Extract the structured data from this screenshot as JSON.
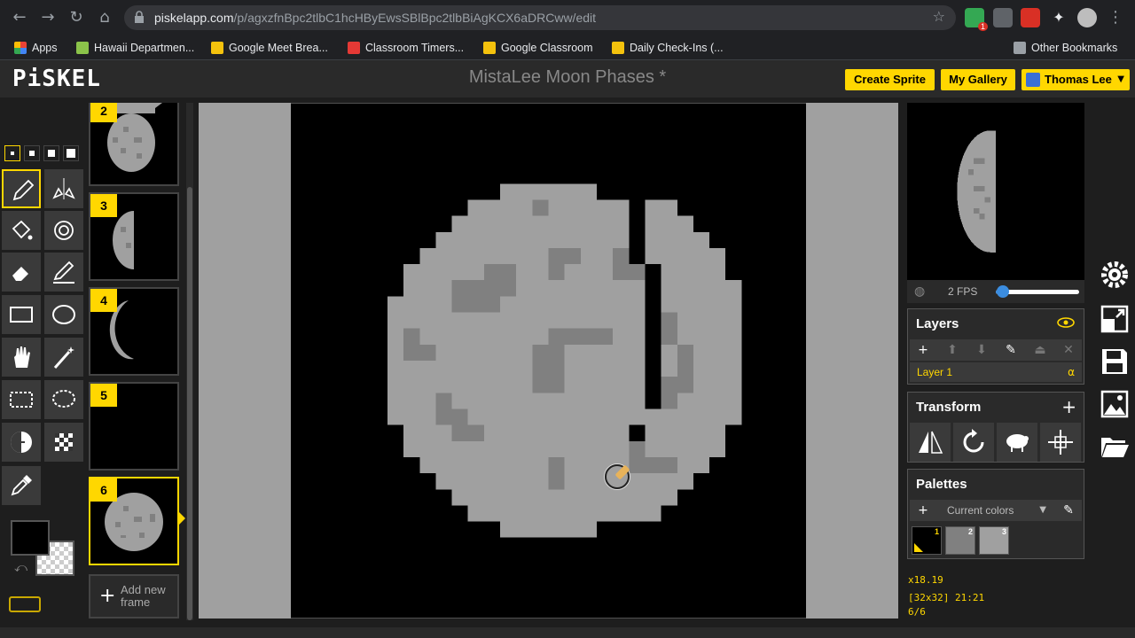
{
  "browser": {
    "url_host": "piskelapp.com",
    "url_path": "/p/agxzfnBpc2tlbC1hcHByEwsSBlBpc2tlbBiAgKCX6aDRCww/edit",
    "ext_badge": "1",
    "bookmarks": [
      {
        "label": "Apps",
        "color": "#ea4335"
      },
      {
        "label": "Hawaii Departmen...",
        "color": "#8bc34a"
      },
      {
        "label": "Google Meet Brea...",
        "color": "#f4c20d"
      },
      {
        "label": "Classroom Timers...",
        "color": "#e53935"
      },
      {
        "label": "Google Classroom",
        "color": "#f4c20d"
      },
      {
        "label": "Daily Check-Ins (...",
        "color": "#f4c20d"
      }
    ],
    "other_bookmarks": "Other Bookmarks"
  },
  "header": {
    "logo": "PiSKEL",
    "title": "MistaLee Moon Phases *",
    "create_sprite": "Create Sprite",
    "my_gallery": "My Gallery",
    "user_name": "Thomas Lee"
  },
  "tools": [
    {
      "name": "pen-tool",
      "icon": "pencil-icon",
      "selected": true
    },
    {
      "name": "mirror-pen-tool",
      "icon": "vertical-mirror-icon"
    },
    {
      "name": "paint-bucket-tool",
      "icon": "paint-bucket-icon"
    },
    {
      "name": "paint-all-similar-tool",
      "icon": "color-swap-icon"
    },
    {
      "name": "eraser-tool",
      "icon": "eraser-icon"
    },
    {
      "name": "stroke-tool",
      "icon": "stroke-icon"
    },
    {
      "name": "rectangle-tool",
      "icon": "rectangle-icon"
    },
    {
      "name": "ellipse-tool",
      "icon": "circle-icon"
    },
    {
      "name": "move-tool",
      "icon": "hand-icon"
    },
    {
      "name": "magic-wand-tool",
      "icon": "magic-wand-icon"
    },
    {
      "name": "rectangle-select-tool",
      "icon": "rect-select-icon"
    },
    {
      "name": "lasso-select-tool",
      "icon": "lasso-icon"
    },
    {
      "name": "lighten-tool",
      "icon": "lighten-icon"
    },
    {
      "name": "dithering-tool",
      "icon": "checker-icon"
    },
    {
      "name": "color-picker-tool",
      "icon": "eyedropper-icon"
    }
  ],
  "colors": {
    "primary": "#000000",
    "secondary": "transparent",
    "accent": "#ffd700",
    "moon_light": "#a0a0a0",
    "moon_dark": "#808080"
  },
  "frames": [
    {
      "num": "2",
      "phase": "full-partial"
    },
    {
      "num": "3",
      "phase": "half"
    },
    {
      "num": "4",
      "phase": "crescent"
    },
    {
      "num": "5",
      "phase": "new"
    },
    {
      "num": "6",
      "phase": "full",
      "selected": true
    }
  ],
  "add_frame": {
    "line1": "Add new",
    "line2": "frame"
  },
  "preview": {
    "fps": "2 FPS",
    "fps_value": 2,
    "fps_max": 24
  },
  "layers": {
    "title": "Layers",
    "items": [
      {
        "name": "Layer 1",
        "alpha": "α"
      }
    ]
  },
  "transform": {
    "title": "Transform"
  },
  "palettes": {
    "title": "Palettes",
    "selected": "Current colors",
    "swatches": [
      {
        "num": "1",
        "color": "#000000"
      },
      {
        "num": "2",
        "color": "#808080"
      },
      {
        "num": "3",
        "color": "#a0a0a0"
      }
    ]
  },
  "status": {
    "zoom": "x18.19",
    "size_cursor": "[32x32] 21:21",
    "frame": "6/6"
  }
}
